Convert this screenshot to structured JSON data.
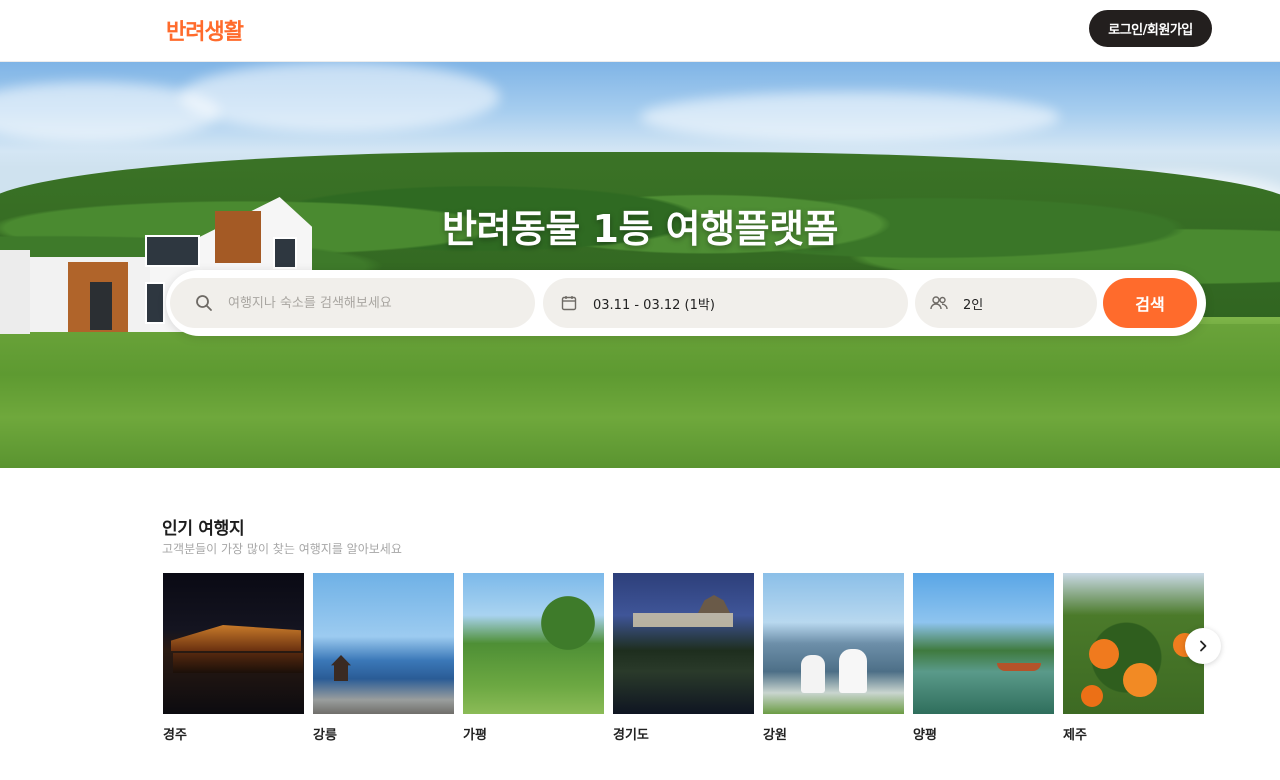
{
  "header": {
    "logo": "반려생활",
    "login_label": "로그인/회원가입"
  },
  "hero": {
    "title": "반려동물 1등 여행플랫폼"
  },
  "search": {
    "placeholder": "여행지나 숙소를 검색해보세요",
    "date": "03.11 - 03.12 (1박)",
    "guests": "2인",
    "button_label": "검색"
  },
  "popular": {
    "title": "인기 여행지",
    "subtitle": "고객분들이 가장 많이 찾는 여행지를 알아보세요",
    "destinations": [
      {
        "name": "경주"
      },
      {
        "name": "강릉"
      },
      {
        "name": "가평"
      },
      {
        "name": "경기도"
      },
      {
        "name": "강원"
      },
      {
        "name": "양평"
      },
      {
        "name": "제주"
      }
    ]
  },
  "colors": {
    "accent": "#ff6b2c",
    "dark_button": "#231f1e",
    "field_bg": "#f1efeb"
  },
  "icons": [
    "search-icon",
    "calendar-icon",
    "users-icon",
    "chevron-right-icon"
  ]
}
